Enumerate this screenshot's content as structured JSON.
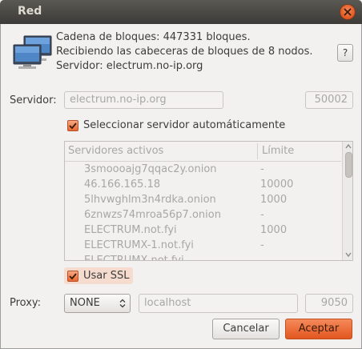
{
  "window": {
    "title": "Red"
  },
  "status": {
    "line1": "Cadena de bloques: 447331 bloques.",
    "line2": "Recibiendo las cabeceras de bloques de 8 nodos.",
    "line3": "Servidor: electrum.no-ip.org"
  },
  "help_label": "?",
  "server": {
    "label": "Servidor:",
    "host": "electrum.no-ip.org",
    "port": "50002",
    "auto_select_label": "Seleccionar servidor automáticamente",
    "auto_select_checked": true
  },
  "servers_table": {
    "headers": [
      "Servidores activos",
      "Límite"
    ],
    "rows": [
      {
        "host": "3smoooajg7qqac2y.onion",
        "limit": "-"
      },
      {
        "host": "46.166.165.18",
        "limit": "10000"
      },
      {
        "host": "5lhvwghlm3n4rdka.onion",
        "limit": "1000"
      },
      {
        "host": "6znwzs74mroa56p7.onion",
        "limit": "-"
      },
      {
        "host": "ELECTRUM.not.fyi",
        "limit": "1000"
      },
      {
        "host": "ELECTRUMX-1.not.fyi",
        "limit": "-"
      },
      {
        "host": "ELECTRUMX.not.fyi",
        "limit": ""
      }
    ]
  },
  "ssl": {
    "label": "Usar SSL",
    "checked": true
  },
  "proxy": {
    "label": "Proxy:",
    "mode": "NONE",
    "host": "localhost",
    "port": "9050"
  },
  "buttons": {
    "cancel": "Cancelar",
    "accept": "Aceptar"
  },
  "colors": {
    "accent": "#e9692f",
    "titlebar": "#3c3b37",
    "background": "#f2f1f0"
  }
}
